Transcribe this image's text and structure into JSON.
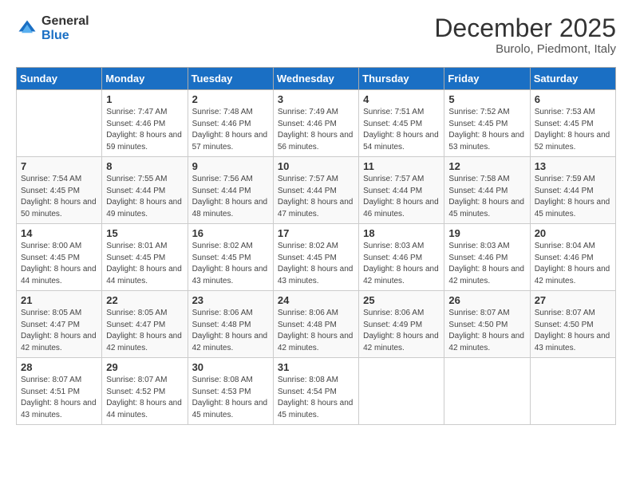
{
  "logo": {
    "general": "General",
    "blue": "Blue"
  },
  "header": {
    "month": "December 2025",
    "location": "Burolo, Piedmont, Italy"
  },
  "weekdays": [
    "Sunday",
    "Monday",
    "Tuesday",
    "Wednesday",
    "Thursday",
    "Friday",
    "Saturday"
  ],
  "weeks": [
    [
      {
        "day": "",
        "sunrise": "",
        "sunset": "",
        "daylight": ""
      },
      {
        "day": "1",
        "sunrise": "Sunrise: 7:47 AM",
        "sunset": "Sunset: 4:46 PM",
        "daylight": "Daylight: 8 hours and 59 minutes."
      },
      {
        "day": "2",
        "sunrise": "Sunrise: 7:48 AM",
        "sunset": "Sunset: 4:46 PM",
        "daylight": "Daylight: 8 hours and 57 minutes."
      },
      {
        "day": "3",
        "sunrise": "Sunrise: 7:49 AM",
        "sunset": "Sunset: 4:46 PM",
        "daylight": "Daylight: 8 hours and 56 minutes."
      },
      {
        "day": "4",
        "sunrise": "Sunrise: 7:51 AM",
        "sunset": "Sunset: 4:45 PM",
        "daylight": "Daylight: 8 hours and 54 minutes."
      },
      {
        "day": "5",
        "sunrise": "Sunrise: 7:52 AM",
        "sunset": "Sunset: 4:45 PM",
        "daylight": "Daylight: 8 hours and 53 minutes."
      },
      {
        "day": "6",
        "sunrise": "Sunrise: 7:53 AM",
        "sunset": "Sunset: 4:45 PM",
        "daylight": "Daylight: 8 hours and 52 minutes."
      }
    ],
    [
      {
        "day": "7",
        "sunrise": "Sunrise: 7:54 AM",
        "sunset": "Sunset: 4:45 PM",
        "daylight": "Daylight: 8 hours and 50 minutes."
      },
      {
        "day": "8",
        "sunrise": "Sunrise: 7:55 AM",
        "sunset": "Sunset: 4:44 PM",
        "daylight": "Daylight: 8 hours and 49 minutes."
      },
      {
        "day": "9",
        "sunrise": "Sunrise: 7:56 AM",
        "sunset": "Sunset: 4:44 PM",
        "daylight": "Daylight: 8 hours and 48 minutes."
      },
      {
        "day": "10",
        "sunrise": "Sunrise: 7:57 AM",
        "sunset": "Sunset: 4:44 PM",
        "daylight": "Daylight: 8 hours and 47 minutes."
      },
      {
        "day": "11",
        "sunrise": "Sunrise: 7:57 AM",
        "sunset": "Sunset: 4:44 PM",
        "daylight": "Daylight: 8 hours and 46 minutes."
      },
      {
        "day": "12",
        "sunrise": "Sunrise: 7:58 AM",
        "sunset": "Sunset: 4:44 PM",
        "daylight": "Daylight: 8 hours and 45 minutes."
      },
      {
        "day": "13",
        "sunrise": "Sunrise: 7:59 AM",
        "sunset": "Sunset: 4:44 PM",
        "daylight": "Daylight: 8 hours and 45 minutes."
      }
    ],
    [
      {
        "day": "14",
        "sunrise": "Sunrise: 8:00 AM",
        "sunset": "Sunset: 4:45 PM",
        "daylight": "Daylight: 8 hours and 44 minutes."
      },
      {
        "day": "15",
        "sunrise": "Sunrise: 8:01 AM",
        "sunset": "Sunset: 4:45 PM",
        "daylight": "Daylight: 8 hours and 44 minutes."
      },
      {
        "day": "16",
        "sunrise": "Sunrise: 8:02 AM",
        "sunset": "Sunset: 4:45 PM",
        "daylight": "Daylight: 8 hours and 43 minutes."
      },
      {
        "day": "17",
        "sunrise": "Sunrise: 8:02 AM",
        "sunset": "Sunset: 4:45 PM",
        "daylight": "Daylight: 8 hours and 43 minutes."
      },
      {
        "day": "18",
        "sunrise": "Sunrise: 8:03 AM",
        "sunset": "Sunset: 4:46 PM",
        "daylight": "Daylight: 8 hours and 42 minutes."
      },
      {
        "day": "19",
        "sunrise": "Sunrise: 8:03 AM",
        "sunset": "Sunset: 4:46 PM",
        "daylight": "Daylight: 8 hours and 42 minutes."
      },
      {
        "day": "20",
        "sunrise": "Sunrise: 8:04 AM",
        "sunset": "Sunset: 4:46 PM",
        "daylight": "Daylight: 8 hours and 42 minutes."
      }
    ],
    [
      {
        "day": "21",
        "sunrise": "Sunrise: 8:05 AM",
        "sunset": "Sunset: 4:47 PM",
        "daylight": "Daylight: 8 hours and 42 minutes."
      },
      {
        "day": "22",
        "sunrise": "Sunrise: 8:05 AM",
        "sunset": "Sunset: 4:47 PM",
        "daylight": "Daylight: 8 hours and 42 minutes."
      },
      {
        "day": "23",
        "sunrise": "Sunrise: 8:06 AM",
        "sunset": "Sunset: 4:48 PM",
        "daylight": "Daylight: 8 hours and 42 minutes."
      },
      {
        "day": "24",
        "sunrise": "Sunrise: 8:06 AM",
        "sunset": "Sunset: 4:48 PM",
        "daylight": "Daylight: 8 hours and 42 minutes."
      },
      {
        "day": "25",
        "sunrise": "Sunrise: 8:06 AM",
        "sunset": "Sunset: 4:49 PM",
        "daylight": "Daylight: 8 hours and 42 minutes."
      },
      {
        "day": "26",
        "sunrise": "Sunrise: 8:07 AM",
        "sunset": "Sunset: 4:50 PM",
        "daylight": "Daylight: 8 hours and 42 minutes."
      },
      {
        "day": "27",
        "sunrise": "Sunrise: 8:07 AM",
        "sunset": "Sunset: 4:50 PM",
        "daylight": "Daylight: 8 hours and 43 minutes."
      }
    ],
    [
      {
        "day": "28",
        "sunrise": "Sunrise: 8:07 AM",
        "sunset": "Sunset: 4:51 PM",
        "daylight": "Daylight: 8 hours and 43 minutes."
      },
      {
        "day": "29",
        "sunrise": "Sunrise: 8:07 AM",
        "sunset": "Sunset: 4:52 PM",
        "daylight": "Daylight: 8 hours and 44 minutes."
      },
      {
        "day": "30",
        "sunrise": "Sunrise: 8:08 AM",
        "sunset": "Sunset: 4:53 PM",
        "daylight": "Daylight: 8 hours and 45 minutes."
      },
      {
        "day": "31",
        "sunrise": "Sunrise: 8:08 AM",
        "sunset": "Sunset: 4:54 PM",
        "daylight": "Daylight: 8 hours and 45 minutes."
      },
      {
        "day": "",
        "sunrise": "",
        "sunset": "",
        "daylight": ""
      },
      {
        "day": "",
        "sunrise": "",
        "sunset": "",
        "daylight": ""
      },
      {
        "day": "",
        "sunrise": "",
        "sunset": "",
        "daylight": ""
      }
    ]
  ]
}
